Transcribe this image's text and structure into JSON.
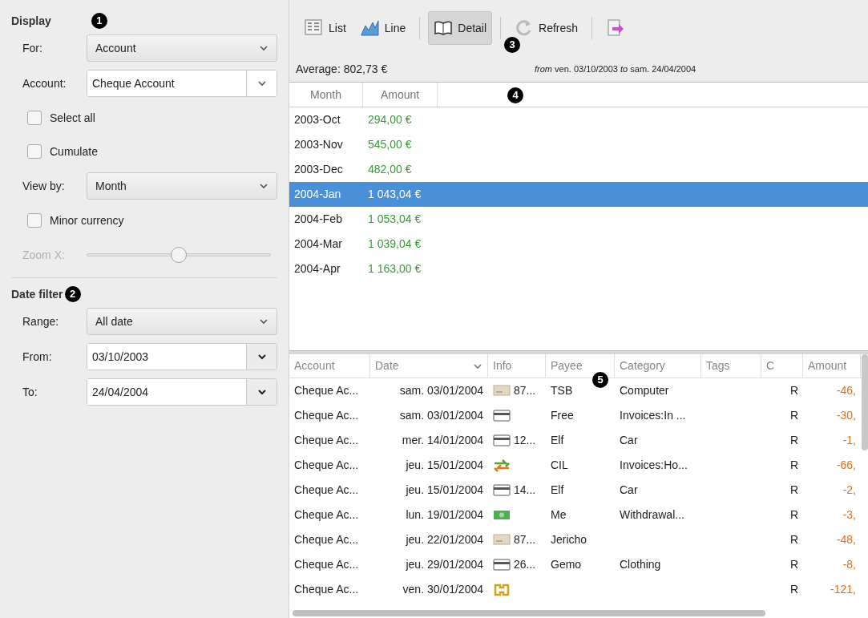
{
  "display": {
    "title": "Display",
    "callout": "1",
    "fields": [
      {
        "kind": "combo",
        "label": "For:",
        "value": "Account"
      },
      {
        "kind": "editcombo",
        "label": "Account:",
        "value": "Cheque Account"
      },
      {
        "kind": "checkbox",
        "label": "Select all",
        "checked": false
      },
      {
        "kind": "checkbox",
        "label": "Cumulate",
        "checked": false
      },
      {
        "kind": "combo",
        "label": "View by:",
        "value": "Month"
      },
      {
        "kind": "checkbox",
        "label": "Minor currency",
        "checked": false
      },
      {
        "kind": "slider",
        "label": "Zoom X:",
        "level": 0.5,
        "disabled": true
      }
    ]
  },
  "date_filter": {
    "title": "Date filter",
    "callout": "2",
    "fields": [
      {
        "kind": "combo",
        "label": "Range:",
        "value": "All date"
      },
      {
        "kind": "date",
        "label": "From:",
        "value": "03/10/2003"
      },
      {
        "kind": "date",
        "label": "To:",
        "value": "24/04/2004"
      }
    ]
  },
  "toolbar": {
    "callout": "3",
    "items": [
      {
        "kind": "list",
        "label": "List",
        "selected": false
      },
      {
        "kind": "line",
        "label": "Line",
        "selected": false
      },
      {
        "kind": "separator"
      },
      {
        "kind": "detail",
        "label": "Detail",
        "selected": true
      },
      {
        "kind": "separator"
      },
      {
        "kind": "refresh",
        "label": "Refresh",
        "selected": false
      },
      {
        "kind": "separator"
      },
      {
        "kind": "export",
        "selected": false
      }
    ]
  },
  "summary": {
    "average": "Average: 802,73 €",
    "period": "*from* ven. 03/10/2003 *to* sam. 24/04/2004"
  },
  "month_table": {
    "callout": "4",
    "columns": [
      "Month",
      "Amount"
    ],
    "rows": [
      {
        "month": "2003-Oct",
        "amount": "294,00 €",
        "selected": false
      },
      {
        "month": "2003-Nov",
        "amount": "545,00 €",
        "selected": false
      },
      {
        "month": "2003-Dec",
        "amount": "482,00 €",
        "selected": false
      },
      {
        "month": "2004-Jan",
        "amount": "1 043,04 €",
        "selected": true
      },
      {
        "month": "2004-Feb",
        "amount": "1 053,04 €",
        "selected": false
      },
      {
        "month": "2004-Mar",
        "amount": "1 039,04 €",
        "selected": false
      },
      {
        "month": "2004-Apr",
        "amount": "1 163,00 €",
        "selected": false
      }
    ]
  },
  "detail_table": {
    "callout": "5",
    "columns": [
      "Account",
      "Date",
      "Info",
      "Payee",
      "Category",
      "Tags",
      "C",
      "Amount"
    ],
    "rows": [
      {
        "account": "Cheque Ac...",
        "date": "sam. 03/01/2004",
        "info": {
          "kind": "cheque",
          "text": "87..."
        },
        "payee": "TSB",
        "category": "Computer",
        "status": "R",
        "amount": "-46,"
      },
      {
        "account": "Cheque Ac...",
        "date": "sam. 03/01/2004",
        "info": {
          "kind": "card"
        },
        "payee": "Free",
        "category": "Invoices:In ...",
        "status": "R",
        "amount": "-30,"
      },
      {
        "account": "Cheque Ac...",
        "date": "mer. 14/01/2004",
        "info": {
          "kind": "card",
          "text": "12..."
        },
        "payee": "Elf",
        "category": "Car",
        "status": "R",
        "amount": "-1,"
      },
      {
        "account": "Cheque Ac...",
        "date": "jeu. 15/01/2004",
        "info": {
          "kind": "transfer"
        },
        "payee": "CIL",
        "category": "Invoices:Ho...",
        "status": "R",
        "amount": "-66,"
      },
      {
        "account": "Cheque Ac...",
        "date": "jeu. 15/01/2004",
        "info": {
          "kind": "card",
          "text": "14..."
        },
        "payee": "Elf",
        "category": "Car",
        "status": "R",
        "amount": "-2,"
      },
      {
        "account": "Cheque Ac...",
        "date": "lun. 19/01/2004",
        "info": {
          "kind": "cash"
        },
        "payee": "Me",
        "category": "Withdrawal...",
        "status": "R",
        "amount": "-3,"
      },
      {
        "account": "Cheque Ac...",
        "date": "jeu. 22/01/2004",
        "info": {
          "kind": "cheque",
          "text": "87..."
        },
        "payee": "Jericho",
        "status": "R",
        "amount": "-48,"
      },
      {
        "account": "Cheque Ac...",
        "date": "jeu. 29/01/2004",
        "info": {
          "kind": "card",
          "text": "26..."
        },
        "payee": "Gemo",
        "category": "Clothing",
        "status": "R",
        "amount": "-8,"
      },
      {
        "account": "Cheque Ac...",
        "date": "ven. 30/01/2004",
        "info": {
          "kind": "debit"
        },
        "status": "R",
        "amount": "-121,"
      }
    ]
  }
}
